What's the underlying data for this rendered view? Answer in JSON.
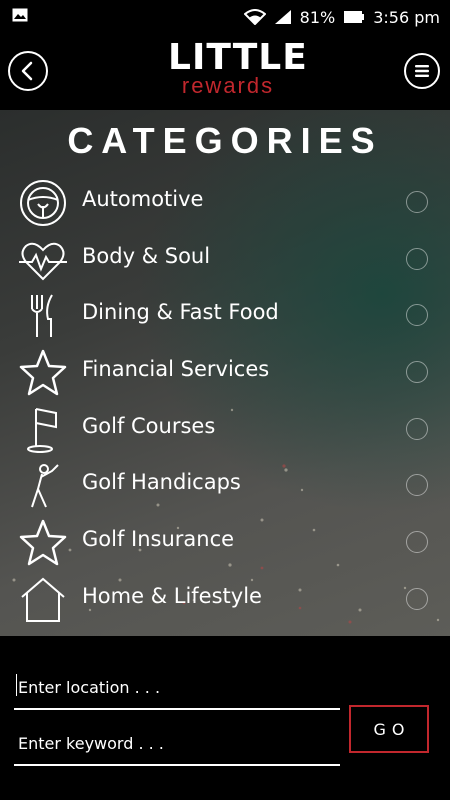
{
  "status_bar": {
    "battery": "81%",
    "time": "3:56 pm"
  },
  "header": {
    "logo_top": "LITTLE",
    "logo_bottom": "rewards"
  },
  "page_title": "CATEGORIES",
  "categories": [
    {
      "label": "Automotive",
      "icon": "steering-wheel-icon"
    },
    {
      "label": "Body & Soul",
      "icon": "heartbeat-icon"
    },
    {
      "label": "Dining & Fast Food",
      "icon": "fork-knife-icon"
    },
    {
      "label": "Financial Services",
      "icon": "star-icon"
    },
    {
      "label": "Golf Courses",
      "icon": "golf-flag-icon"
    },
    {
      "label": "Golf Handicaps",
      "icon": "golfer-icon"
    },
    {
      "label": "Golf Insurance",
      "icon": "star-icon"
    },
    {
      "label": "Home & Lifestyle",
      "icon": "house-icon"
    }
  ],
  "search": {
    "location_placeholder": "Enter location . . .",
    "keyword_placeholder": "Enter keyword . . .",
    "go_label": "GO"
  },
  "colors": {
    "accent": "#c1272d",
    "background": "#000000"
  }
}
